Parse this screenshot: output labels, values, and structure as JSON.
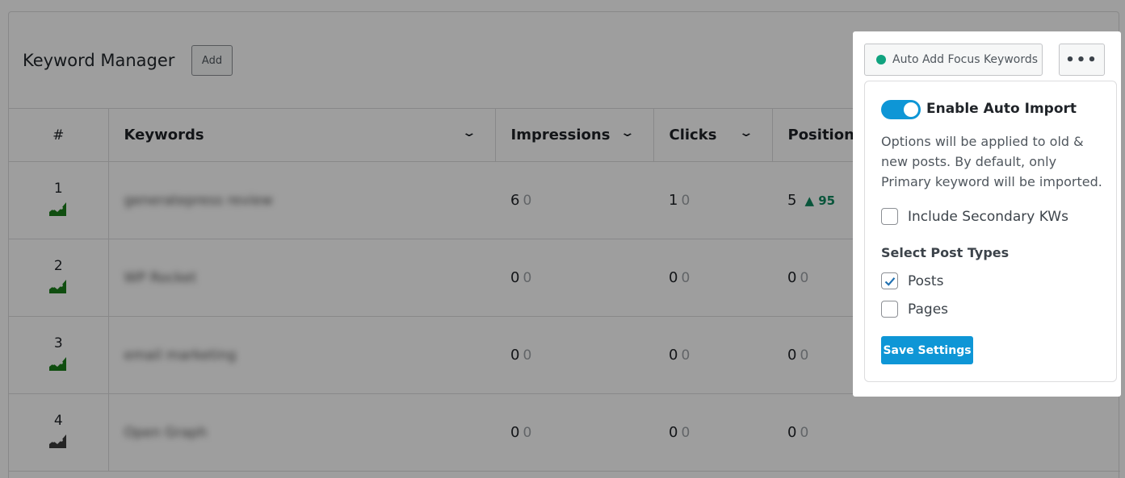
{
  "header": {
    "title": "Keyword Manager",
    "add_label": "Add"
  },
  "table": {
    "columns": [
      "#",
      "Keywords",
      "Impressions",
      "Clicks",
      "Position"
    ],
    "rows": [
      {
        "rank": "1",
        "keyword": "generatepress review",
        "impressions": "6",
        "impressions_change": "0",
        "clicks": "1",
        "clicks_change": "0",
        "position": "5",
        "position_change": "95",
        "trend_color": "#1a7f1a"
      },
      {
        "rank": "2",
        "keyword": "WP Rocket",
        "impressions": "0",
        "impressions_change": "0",
        "clicks": "0",
        "clicks_change": "0",
        "position": "0",
        "position_change": "0",
        "trend_color": "#1a7f1a"
      },
      {
        "rank": "3",
        "keyword": "email marketing",
        "impressions": "0",
        "impressions_change": "0",
        "clicks": "0",
        "clicks_change": "0",
        "position": "0",
        "position_change": "0",
        "trend_color": "#1a7f1a"
      },
      {
        "rank": "4",
        "keyword": "Open Graph",
        "impressions": "0",
        "impressions_change": "0",
        "clicks": "0",
        "clicks_change": "0",
        "position": "0",
        "position_change": "0",
        "trend_color": "#3c3c3c"
      }
    ]
  },
  "toolbar": {
    "auto_add_label": "Auto Add Focus Keywords",
    "more_label": "•••"
  },
  "settings": {
    "toggle_label": "Enable Auto Import",
    "toggle_on": true,
    "description": "Options will be applied to old & new posts. By default, only Primary keyword will be imported.",
    "include_secondary_label": "Include Secondary KWs",
    "include_secondary_checked": false,
    "post_types_title": "Select Post Types",
    "post_types": [
      {
        "label": "Posts",
        "checked": true
      },
      {
        "label": "Pages",
        "checked": false
      }
    ],
    "save_label": "Save Settings"
  },
  "colors": {
    "accent": "#0e96d6",
    "status_dot": "#10a37f",
    "position_up": "#0f8a5f"
  }
}
